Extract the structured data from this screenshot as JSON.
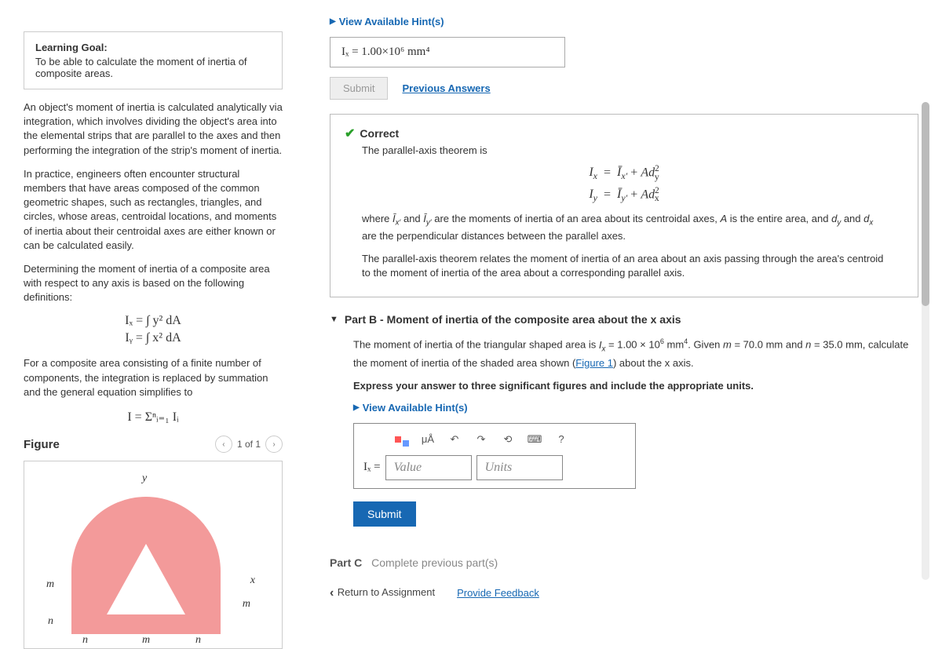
{
  "left": {
    "goal_title": "Learning Goal:",
    "goal_text": "To be able to calculate the moment of inertia of composite areas.",
    "para1": "An object's moment of inertia is calculated analytically via integration, which involves dividing the object's area into the elemental strips that are parallel to the axes and then performing the integration of the strip's moment of inertia.",
    "para2": "In practice, engineers often encounter structural members that have areas composed of the common geometric shapes, such as rectangles, triangles, and circles, whose areas, centroidal locations, and moments of inertia about their centroidal axes are either known or can be calculated easily.",
    "para3": "Determining the moment of inertia of a composite area with respect to any axis is based on the following definitions:",
    "eq1": "Iₓ   =   ∫ y² dA",
    "eq2": "Iᵧ   =   ∫ x² dA",
    "para4": "For a composite area consisting of a finite number of components, the integration is replaced by summation and the general equation simplifies to",
    "eq3": "I = Σⁿᵢ₌₁ Iᵢ",
    "figure_label": "Figure",
    "pager": "1 of 1",
    "axis_y": "y",
    "axis_x": "x",
    "dim_m": "m",
    "dim_n": "n"
  },
  "right": {
    "hints": "View Available Hint(s)",
    "partA_answer": "Iₓ = 1.00×10⁶ mm⁴",
    "submit_disabled": "Submit",
    "prev_ans": "Previous Answers",
    "correct": "Correct",
    "correct_sub": "The parallel-axis theorem is",
    "math1": "Iₓ   =   Ī x′ + Ad²y",
    "math2": "Iᵧ   =   Ī y′ + Ad²x",
    "explain1_a": "where ",
    "explain1_math1": "Ī x′",
    "explain1_b": " and ",
    "explain1_math2": "Ī y′",
    "explain1_c": " are the moments of inertia of an area about its centroidal axes, ",
    "explain1_A": "A",
    "explain1_d": " is the entire area, and ",
    "explain1_dy": "dy",
    "explain1_e": " and ",
    "explain1_dx": "dx",
    "explain1_f": " are the perpendicular distances between the parallel axes.",
    "explain2": "The parallel-axis theorem relates the moment of inertia of an area about an axis passing through the area's centroid to the moment of inertia of the area about a corresponding parallel axis.",
    "partB_title": "Part B - Moment of inertia of the composite area about the x axis",
    "partB_p1_a": "The moment of inertia of the triangular shaped area is ",
    "partB_p1_math": "Iₓ = 1.00 × 10⁶ mm⁴",
    "partB_p1_b": ". Given ",
    "partB_p1_m": "m = 70.0 mm",
    "partB_p1_c": " and ",
    "partB_p1_n": "n = 35.0 mm",
    "partB_p1_d": ", calculate the moment of inertia of the shaded area shown (",
    "partB_fig": "Figure 1",
    "partB_p1_e": ") about the x axis.",
    "partB_instruct": "Express your answer to three significant figures and include the appropriate units.",
    "tb_units": "μÅ",
    "ix_eq": "Iₓ =",
    "value_ph": "Value",
    "units_ph": "Units",
    "submit": "Submit",
    "partC_label": "Part C",
    "partC_text": "Complete previous part(s)",
    "return": "Return to Assignment",
    "feedback": "Provide Feedback"
  }
}
